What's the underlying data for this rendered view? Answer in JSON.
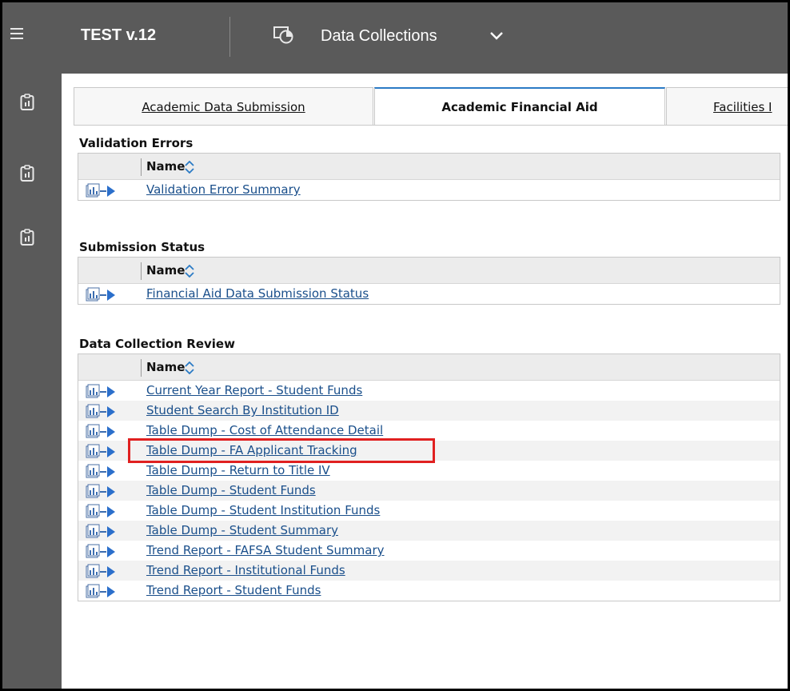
{
  "header": {
    "app_title": "TEST v.12",
    "nav_label": "Data Collections",
    "nav_icon": "data-collections-icon",
    "menu_icon": "hamburger-menu-icon"
  },
  "sidebar": {
    "items": [
      {
        "icon": "report-clipboard-icon"
      },
      {
        "icon": "report-clipboard-icon"
      },
      {
        "icon": "report-clipboard-icon"
      }
    ]
  },
  "tabs": [
    {
      "label": "Academic Data Submission"
    },
    {
      "label": "Academic Financial Aid",
      "active": true
    },
    {
      "label": "Facilities I"
    }
  ],
  "column_header": "Name",
  "sections": {
    "validation": {
      "title": "Validation Errors",
      "rows": [
        "Validation Error Summary"
      ]
    },
    "submission": {
      "title": "Submission Status",
      "rows": [
        "Financial Aid Data Submission Status"
      ]
    },
    "review": {
      "title": "Data Collection Review",
      "rows": [
        "Current Year Report - Student Funds",
        "Student Search By Institution ID",
        "Table Dump - Cost of Attendance Detail",
        "Table Dump - FA Applicant Tracking",
        "Table Dump - Return to Title IV",
        "Table Dump - Student Funds",
        "Table Dump - Student Institution Funds",
        "Table Dump - Student Summary",
        "Trend Report - FAFSA Student Summary",
        "Trend Report - Institutional Funds",
        "Trend Report - Student Funds"
      ],
      "highlighted_row": "Table Dump - FA Applicant Tracking"
    }
  },
  "colors": {
    "topbar": "#5a5a5a",
    "link": "#1a4f8b",
    "active_tab_accent": "#2b7bc5",
    "highlight_box": "#e02020"
  }
}
